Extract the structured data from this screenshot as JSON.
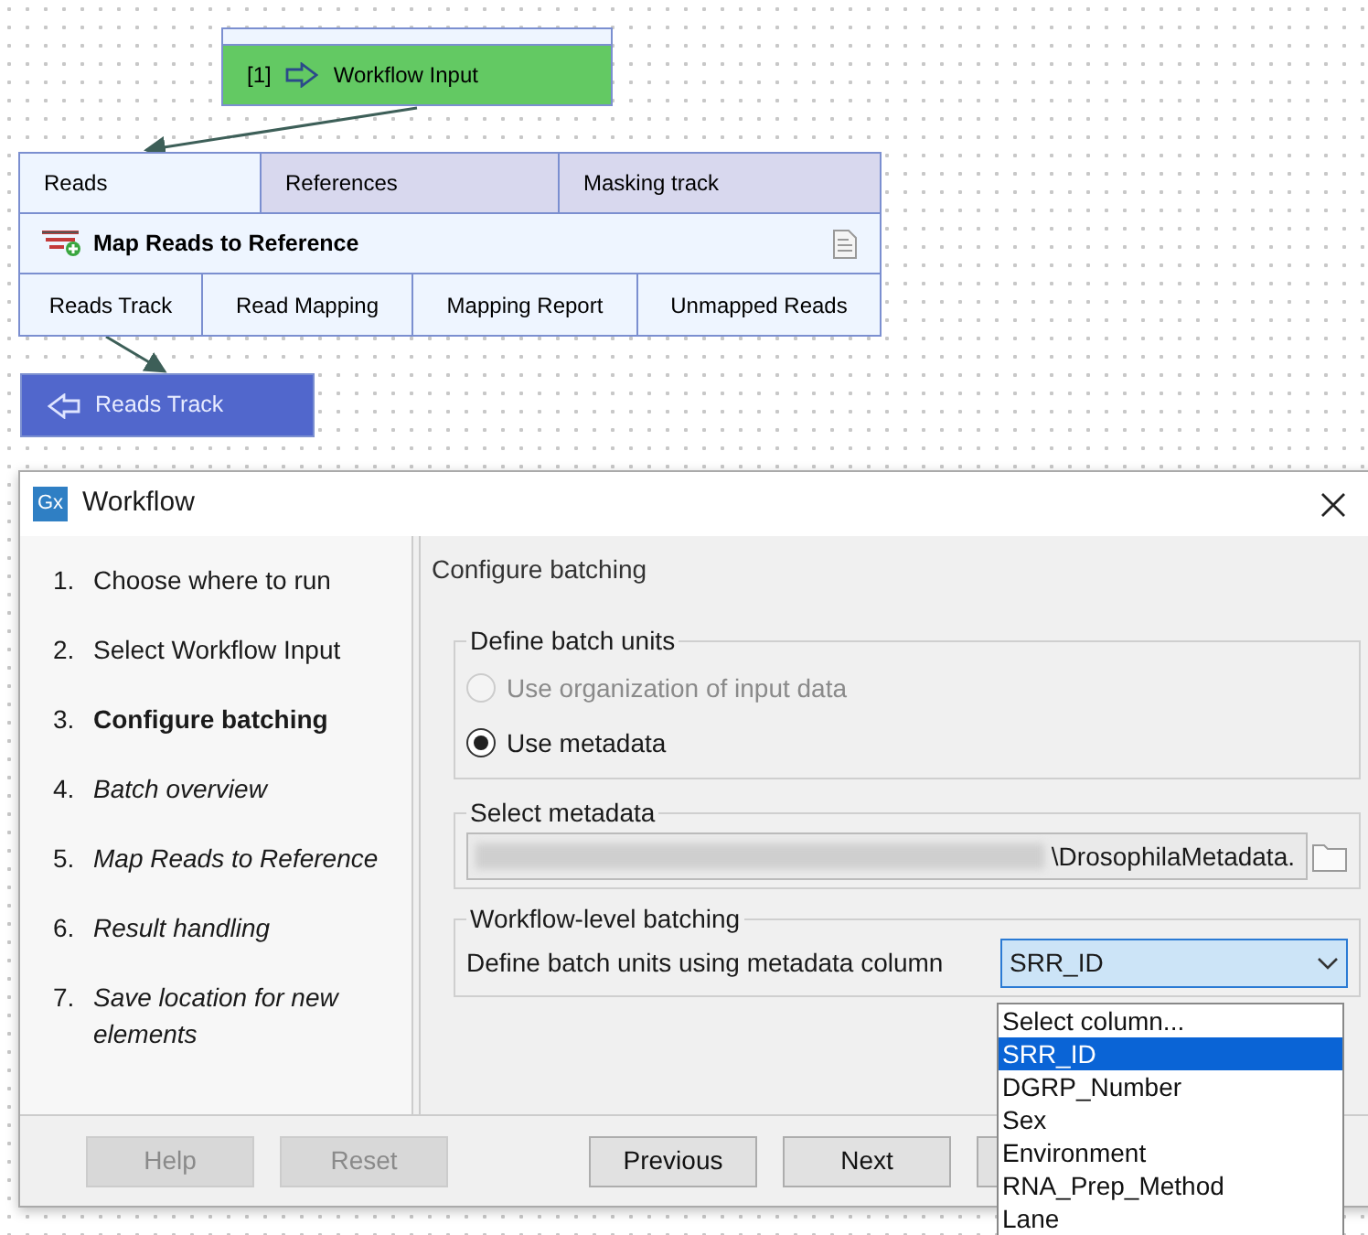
{
  "canvas": {
    "input_node": {
      "index": "[1]",
      "title": "Workflow Input"
    },
    "tool_node": {
      "inputs": [
        "Reads",
        "References",
        "Masking track"
      ],
      "title": "Map Reads to Reference",
      "outputs": [
        "Reads Track",
        "Read Mapping",
        "Mapping Report",
        "Unmapped Reads"
      ]
    },
    "output_node": {
      "title": "Reads Track"
    }
  },
  "dialog": {
    "logo": "Gx",
    "title": "Workflow",
    "steps": [
      {
        "number": "1.",
        "label": "Choose where to run",
        "selected": false,
        "kind": "visited"
      },
      {
        "number": "2.",
        "label": "Select Workflow Input",
        "selected": false,
        "kind": "visited"
      },
      {
        "number": "3.",
        "label": "Configure batching",
        "selected": true,
        "kind": "visited"
      },
      {
        "number": "4.",
        "label": "Batch overview",
        "selected": false,
        "kind": "pending"
      },
      {
        "number": "5.",
        "label": "Map Reads to Reference",
        "selected": false,
        "kind": "pending"
      },
      {
        "number": "6.",
        "label": "Result handling",
        "selected": false,
        "kind": "pending"
      },
      {
        "number": "7.",
        "label": "Save location for new elements",
        "selected": false,
        "kind": "pending"
      }
    ],
    "panel_title": "Configure batching",
    "batch_units": {
      "legend": "Define batch units",
      "options": [
        {
          "label": "Use organization of input data",
          "selected": false,
          "disabled": true
        },
        {
          "label": "Use metadata",
          "selected": true,
          "disabled": false
        }
      ]
    },
    "select_metadata": {
      "legend": "Select metadata",
      "value": "\\DrosophilaMetadata."
    },
    "workflow_batching": {
      "legend": "Workflow-level batching",
      "label": "Define batch units using metadata column",
      "value": "SRR_ID",
      "options": [
        {
          "label": "Select column...",
          "selected": false
        },
        {
          "label": "SRR_ID",
          "selected": true
        },
        {
          "label": "DGRP_Number",
          "selected": false
        },
        {
          "label": "Sex",
          "selected": false
        },
        {
          "label": "Environment",
          "selected": false
        },
        {
          "label": "RNA_Prep_Method",
          "selected": false
        },
        {
          "label": "Lane",
          "selected": false
        }
      ]
    },
    "buttons": [
      {
        "label": "Help",
        "disabled": true
      },
      {
        "label": "Reset",
        "disabled": true
      },
      {
        "label": "Previous",
        "disabled": false
      },
      {
        "label": "Next",
        "disabled": false
      }
    ]
  }
}
